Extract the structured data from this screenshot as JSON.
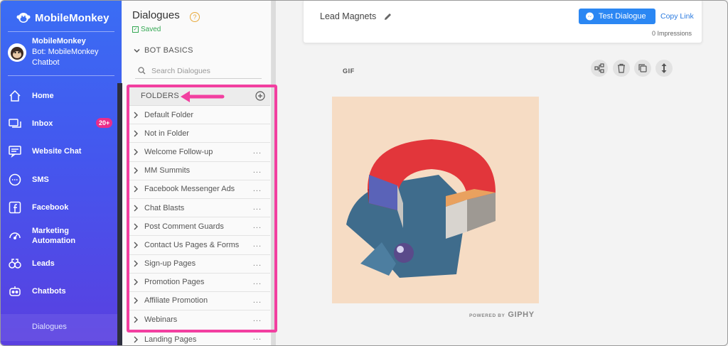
{
  "sidebar": {
    "brand": "MobileMonkey",
    "account_name": "MobileMonkey",
    "bot_name": "Bot: MobileMonkey Chatbot",
    "nav": [
      {
        "label": "Home",
        "icon": "home-icon"
      },
      {
        "label": "Inbox",
        "icon": "inbox-icon",
        "badge": "20+"
      },
      {
        "label": "Website Chat",
        "icon": "website-chat-icon"
      },
      {
        "label": "SMS",
        "icon": "sms-icon"
      },
      {
        "label": "Facebook",
        "icon": "facebook-icon"
      },
      {
        "label": "Marketing Automation",
        "icon": "marketing-automation-icon"
      },
      {
        "label": "Leads",
        "icon": "leads-icon"
      },
      {
        "label": "Chatbots",
        "icon": "chatbots-icon"
      }
    ],
    "sub_item": "Dialogues"
  },
  "dialogues": {
    "title": "Dialogues",
    "help": "?",
    "saved": "Saved",
    "section": "BOT BASICS",
    "search_placeholder": "Search Dialogues",
    "folders_header": "FOLDERS",
    "folders": [
      {
        "label": "Default Folder",
        "has_menu": false
      },
      {
        "label": "Not in Folder",
        "has_menu": false
      },
      {
        "label": "Welcome Follow-up",
        "has_menu": true
      },
      {
        "label": "MM Summits",
        "has_menu": true
      },
      {
        "label": "Facebook Messenger Ads",
        "has_menu": true
      },
      {
        "label": "Chat Blasts",
        "has_menu": true
      },
      {
        "label": "Post Comment Guards",
        "has_menu": true
      },
      {
        "label": "Contact Us Pages & Forms",
        "has_menu": true
      },
      {
        "label": "Sign-up Pages",
        "has_menu": true
      },
      {
        "label": "Promotion Pages",
        "has_menu": true
      },
      {
        "label": "Affiliate Promotion",
        "has_menu": true
      },
      {
        "label": "Webinars",
        "has_menu": true
      }
    ],
    "overflow_folder": "Landing Pages",
    "menu_glyph": "..."
  },
  "editor": {
    "dialogue_name": "Lead Magnets",
    "test_button": "Test Dialogue",
    "copy_link": "Copy Link",
    "impressions": "0 Impressions",
    "block_label": "GIF",
    "giphy_powered": "POWERED BY",
    "giphy_brand": "GIPHY"
  },
  "colors": {
    "sidebar_top": "#3a6df4",
    "sidebar_bottom": "#5a3fe0",
    "badge": "#ea2d8a",
    "highlight_annotation": "#f23fa0",
    "primary_button": "#2b87f3",
    "saved_green": "#34a853"
  }
}
